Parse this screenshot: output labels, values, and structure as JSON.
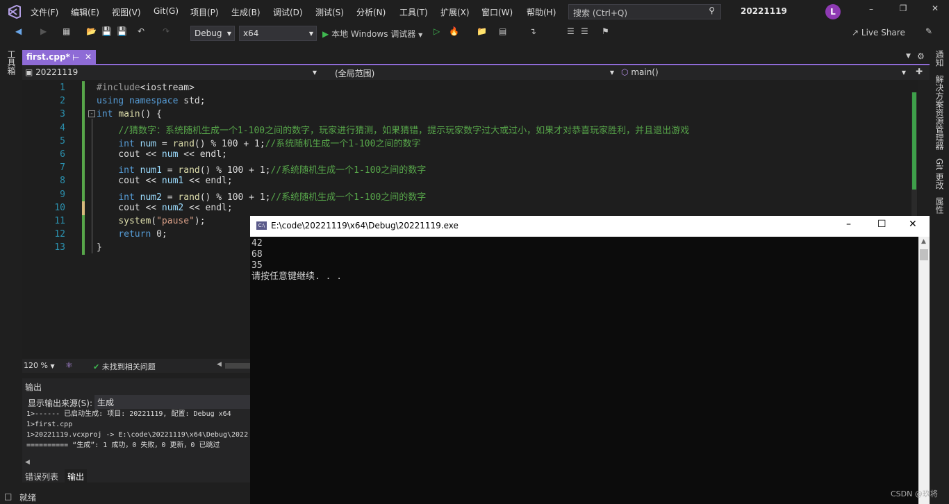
{
  "menubar": {
    "items": [
      "文件(F)",
      "编辑(E)",
      "视图(V)",
      "Git(G)",
      "项目(P)",
      "生成(B)",
      "调试(D)",
      "测试(S)",
      "分析(N)",
      "工具(T)",
      "扩展(X)",
      "窗口(W)",
      "帮助(H)"
    ],
    "search_placeholder": "搜索 (Ctrl+Q)",
    "solution_name": "20221119",
    "avatar_letter": "L"
  },
  "toolbar": {
    "config": "Debug",
    "platform": "x64",
    "debugger": "本地 Windows 调试器",
    "live_share": "Live Share"
  },
  "left_rail": {
    "label": "工具箱"
  },
  "right_rail": {
    "labels": [
      "通知",
      "解决方案资源管理器",
      "Git 更改",
      "属性"
    ]
  },
  "editor": {
    "tab_title": "first.cpp*",
    "nav_project": "20221119",
    "nav_scope": "(全局范围)",
    "nav_member": "main()",
    "zoom": "120 %",
    "issues": "未找到相关问题",
    "line_numbers": [
      "1",
      "2",
      "3",
      "4",
      "5",
      "6",
      "7",
      "8",
      "9",
      "10",
      "11",
      "12",
      "13"
    ],
    "lines": [
      "#include<iostream>",
      "using namespace std;",
      "int main() {",
      "    //猜数字：系统随机生成一个1-100之间的数字，玩家进行猜测，如果猜错，提示玩家数字过大或过小，如果才对恭喜玩家胜利，并且退出游戏",
      "    int num = rand() % 100 + 1;//系统随机生成一个1-100之间的数字",
      "    cout << num << endl;",
      "    int num1 = rand() % 100 + 1;//系统随机生成一个1-100之间的数字",
      "    cout << num1 << endl;",
      "    int num2 = rand() % 100 + 1;//系统随机生成一个1-100之间的数字",
      "    cout << num2 << endl;",
      "    system(\"pause\");",
      "    return 0;",
      "}"
    ]
  },
  "output": {
    "title": "输出",
    "source_label": "显示输出来源(S):",
    "source_value": "生成",
    "lines": [
      "1>------ 已启动生成: 项目: 20221119, 配置: Debug x64",
      "1>first.cpp",
      "1>20221119.vcxproj -> E:\\code\\20221119\\x64\\Debug\\2022",
      "========== “生成”: 1 成功，0 失败，0 更新，0 已跳过"
    ],
    "tabs": [
      "错误列表",
      "输出"
    ]
  },
  "console": {
    "title": "E:\\code\\20221119\\x64\\Debug\\20221119.exe",
    "lines": [
      "42",
      "68",
      "35",
      "请按任意键继续. . ."
    ]
  },
  "status": {
    "ready": "就绪"
  },
  "watermark": "CSDN @玖将"
}
